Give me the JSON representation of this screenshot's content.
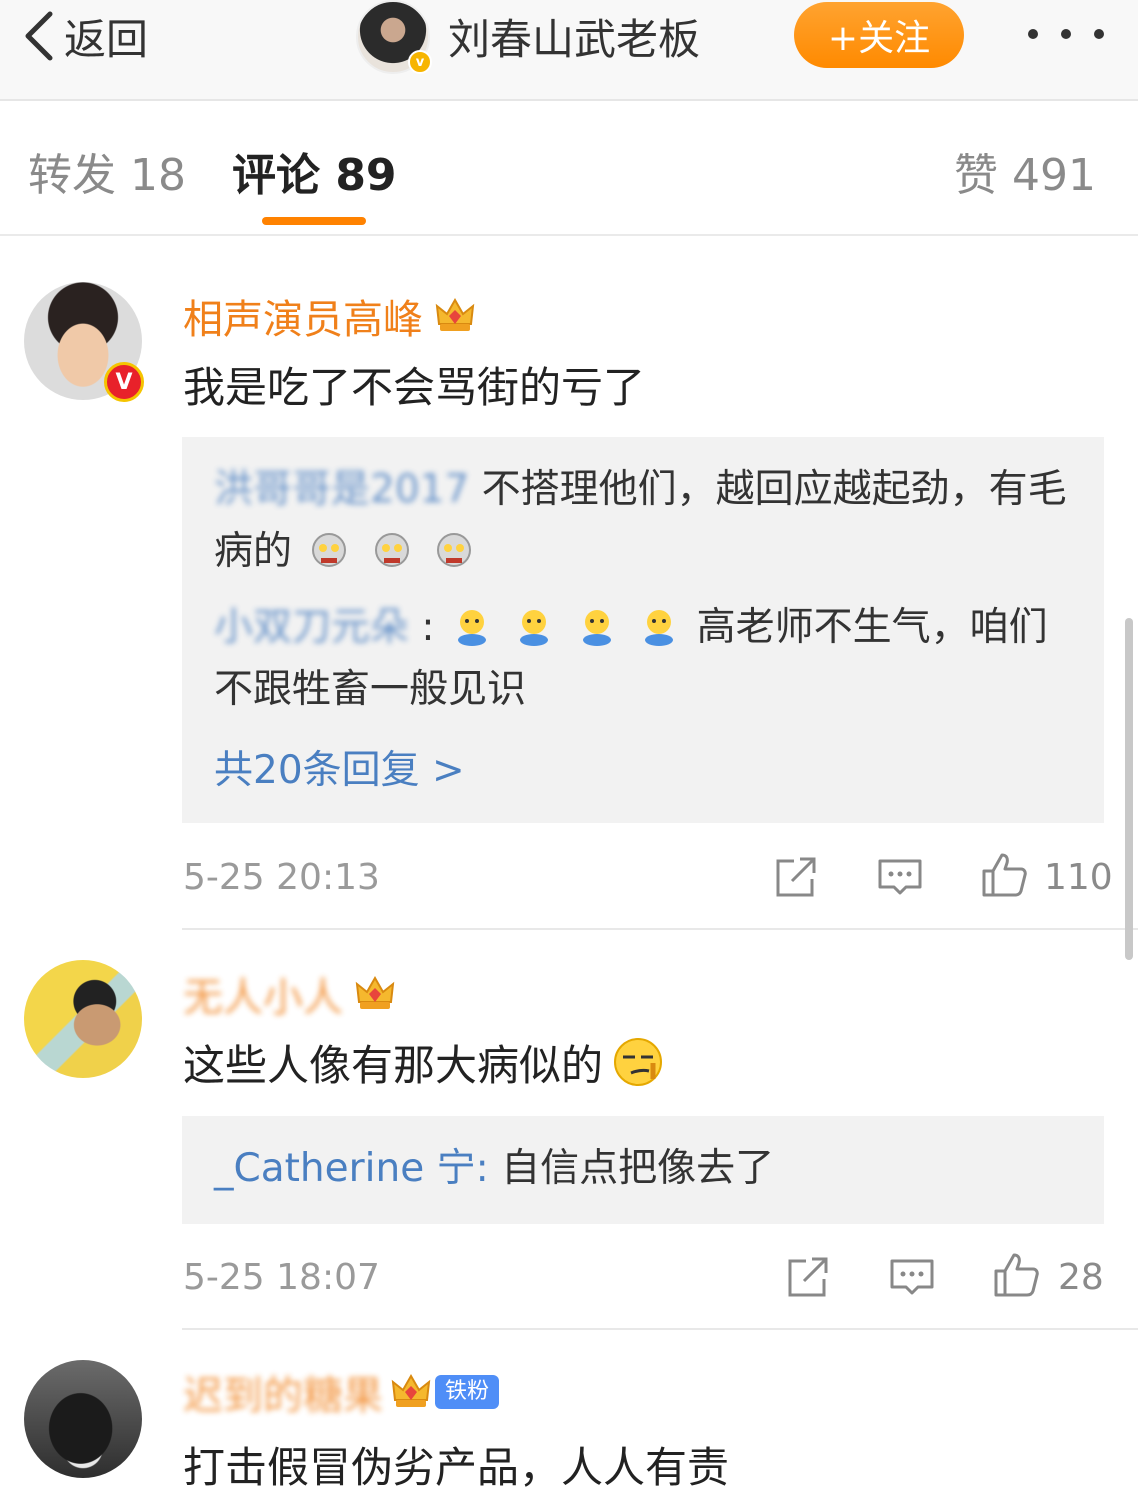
{
  "header": {
    "back_label": "返回",
    "account_name": "刘春山武老板",
    "follow_label": "+关注",
    "verified_mark": "v"
  },
  "tabs": {
    "repost": "转发 18",
    "comments": "评论 89",
    "likes": "赞 491"
  },
  "comments": [
    {
      "username": "相声演员高峰",
      "verified_mark": "V",
      "text": "我是吃了不会骂街的亏了",
      "replies": [
        {
          "name": "洪哥哥是2017",
          "text": "不搭理他们，越回应越起劲，有毛病的",
          "emoji_count": 3
        },
        {
          "name": "小双刀元朵",
          "text": "高老师不生气，咱们不跟牲畜一般见识",
          "emoji_count": 4
        }
      ],
      "more_replies": "共20条回复 >",
      "time": "5-25 20:13",
      "likes": "110"
    },
    {
      "username": "无人小人",
      "text": "这些人像有那大病似的",
      "replies": [
        {
          "name": "_Catherine 宁",
          "text": "自信点把像去了"
        }
      ],
      "time": "5-25 18:07",
      "likes": "28"
    },
    {
      "username": "迟到的糖果",
      "fan_badge": "铁粉",
      "text": "打击假冒伪劣产品，人人有责"
    }
  ],
  "colors": {
    "accent": "#ff8200",
    "username": "#f0801a",
    "link": "#4a7fc1"
  },
  "icons": [
    "chevron-left-icon",
    "more-dots-icon",
    "crown-icon",
    "share-icon",
    "comment-icon",
    "thumbs-up-icon"
  ]
}
